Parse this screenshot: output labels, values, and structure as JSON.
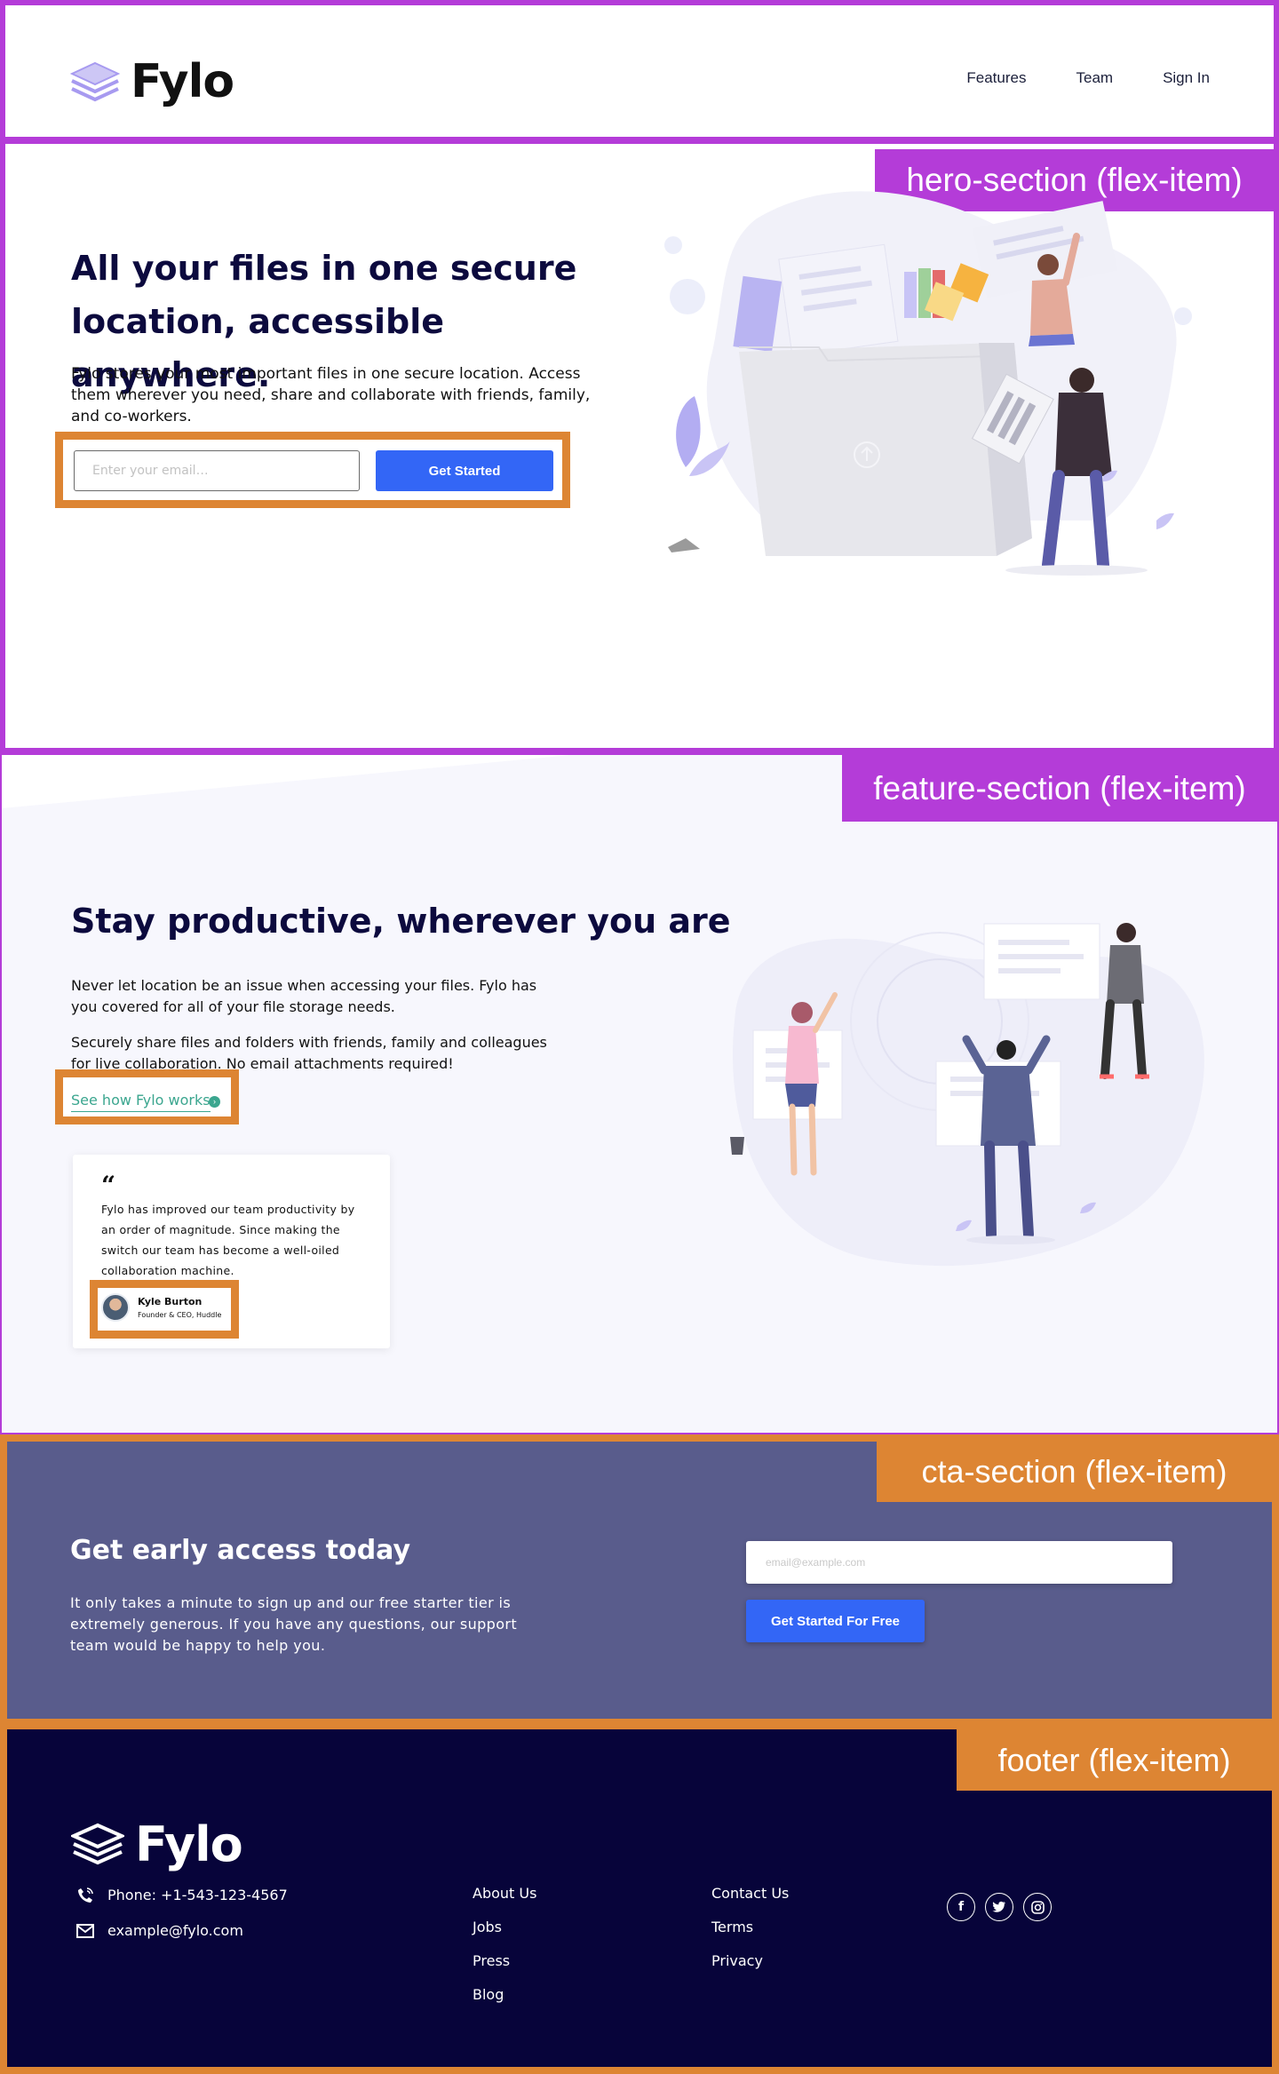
{
  "colors": {
    "flex_container_outline": "#b43cd8",
    "flex_item_outline": "#dd8533",
    "primary_blue": "#3366f6",
    "heading_navy": "#0c0a3e",
    "cta_bg": "#595c8c",
    "footer_bg": "#07043a",
    "link_teal": "#3ba68f"
  },
  "header": {
    "logo_text": "Fylo",
    "logo_icon": "layers-icon",
    "nav": [
      "Features",
      "Team",
      "Sign In"
    ]
  },
  "hero": {
    "tag": "hero-section (flex-item)",
    "title": "All your files in one secure location, accessible anywhere.",
    "description": "Fylo stores your most important files in one secure location. Access them wherever you need, share and collaborate with friends, family, and co-workers.",
    "email_placeholder": "Enter your email…",
    "button_label": "Get Started",
    "illustration": "people-with-folder-illustration"
  },
  "feature": {
    "tag": "feature-section (flex-item)",
    "title": "Stay productive, wherever you are",
    "paragraph_1": "Never let location be an issue when accessing your files. Fylo has you covered for all of your file storage needs.",
    "paragraph_2": "Securely share files and folders with friends, family and colleagues for live collaboration. No email attachments required!",
    "link_label": "See how Fylo works",
    "link_icon": "arrow-circle-icon",
    "testimonial": {
      "quote_mark": "“",
      "text": "Fylo has improved our team productivity by an order of magnitude. Since making the switch our team has become a well-oiled collaboration machine.",
      "author_name": "Kyle Burton",
      "author_role": "Founder & CEO, Huddle"
    },
    "illustration": "team-collaboration-illustration"
  },
  "cta": {
    "tag": "cta-section (flex-item)",
    "title": "Get early access today",
    "description": "It only takes a minute to sign up and our free starter tier is extremely generous. If you have any questions, our support team would be happy to help you.",
    "email_placeholder": "email@example.com",
    "button_label": "Get Started For Free"
  },
  "footer": {
    "tag": "footer (flex-item)",
    "logo_text": "Fylo",
    "phone": "Phone: +1-543-123-4567",
    "email": "example@fylo.com",
    "links_col_1": [
      "About Us",
      "Jobs",
      "Press",
      "Blog"
    ],
    "links_col_2": [
      "Contact Us",
      "Terms",
      "Privacy"
    ],
    "social_icons": [
      "facebook-icon",
      "twitter-icon",
      "instagram-icon"
    ]
  }
}
